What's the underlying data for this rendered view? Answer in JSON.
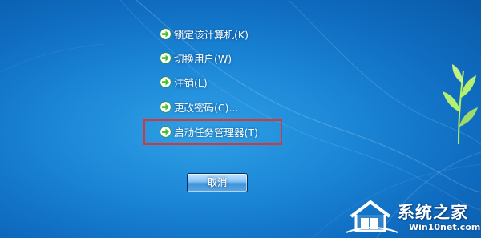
{
  "menu": {
    "items": [
      {
        "label": "锁定该计算机(K)",
        "icon": "green-arrow-icon"
      },
      {
        "label": "切换用户(W)",
        "icon": "green-arrow-icon"
      },
      {
        "label": "注销(L)",
        "icon": "green-arrow-icon"
      },
      {
        "label": "更改密码(C)...",
        "icon": "green-arrow-icon"
      },
      {
        "label": "启动任务管理器(T)",
        "icon": "green-arrow-icon",
        "highlighted": true
      }
    ]
  },
  "cancel_button": {
    "label": "取消"
  },
  "watermark": {
    "brand": "系统之家",
    "url": "Win10net.com"
  },
  "colors": {
    "background": "#1b86d6",
    "highlight_border": "#d23a3a",
    "arrow_icon": "#3fbf2a",
    "text": "#ffffff"
  }
}
